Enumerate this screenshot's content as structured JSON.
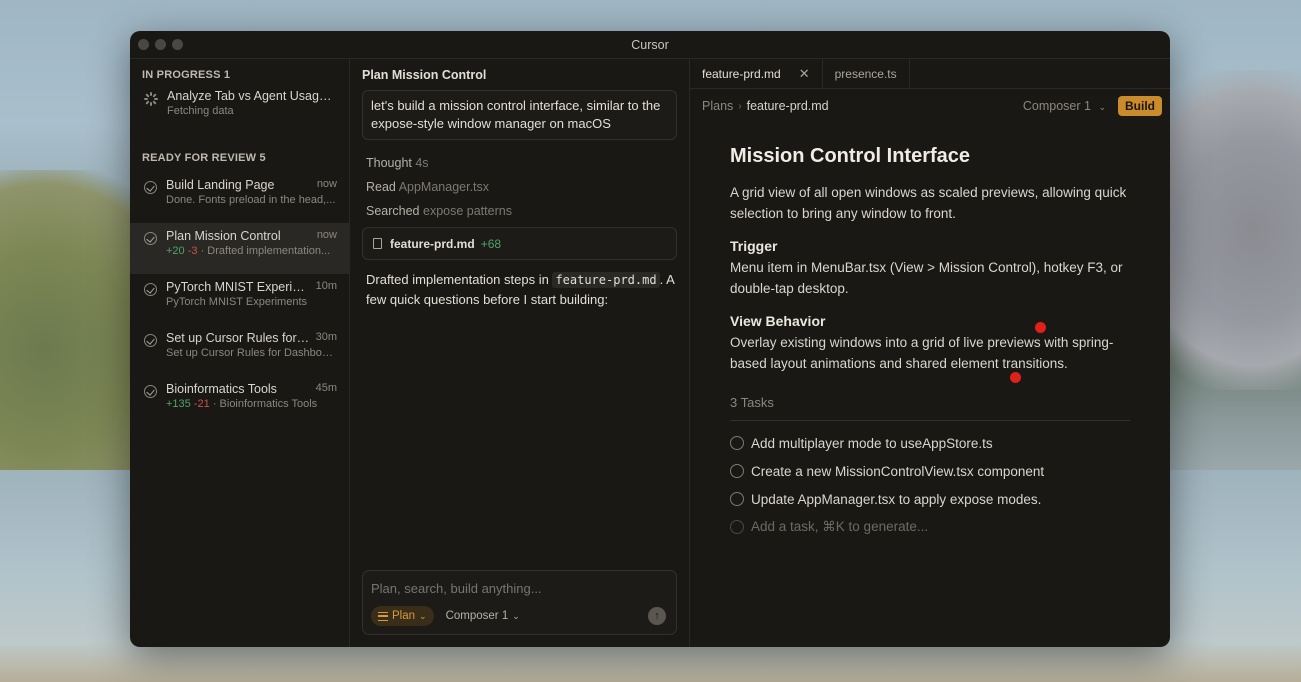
{
  "window": {
    "title": "Cursor"
  },
  "sidebar": {
    "in_progress_header": "IN PROGRESS 1",
    "in_progress": [
      {
        "title": "Analyze Tab vs Agent Usage P...",
        "subtitle": "Fetching data",
        "icon": "spinner-icon"
      }
    ],
    "review_header": "READY FOR REVIEW 5",
    "review": [
      {
        "title": "Build Landing Page",
        "time": "now",
        "plus": "",
        "minus": "",
        "subtitle": "Done. Fonts preload in the head,..."
      },
      {
        "title": "Plan Mission Control",
        "time": "now",
        "plus": "+20",
        "minus": "-3",
        "subtitle": "· Drafted implementation...",
        "active": true
      },
      {
        "title": "PyTorch MNIST Experim...",
        "time": "10m",
        "plus": "",
        "minus": "",
        "subtitle": "PyTorch MNIST Experiments"
      },
      {
        "title": "Set up Cursor Rules for ...",
        "time": "30m",
        "plus": "",
        "minus": "",
        "subtitle": "Set up Cursor Rules for Dashboa..."
      },
      {
        "title": "Bioinformatics Tools",
        "time": "45m",
        "plus": "+135",
        "minus": "-21",
        "subtitle": "· Bioinformatics Tools"
      }
    ]
  },
  "chat": {
    "title": "Plan Mission Control",
    "prompt": "let's build a mission control interface, similar to the expose-style window manager on macOS",
    "thought_label": "Thought",
    "thought_time": "4s",
    "read_label": "Read",
    "read_file": "AppManager.tsx",
    "searched_label": "Searched",
    "searched_query": "expose patterns",
    "file_card": {
      "name": "feature-prd.md",
      "additions": "+68"
    },
    "drafted_prefix": "Drafted implementation steps in",
    "drafted_code": "feature-prd.md",
    "drafted_suffix": ". A few quick questions before I start building:",
    "input_placeholder": "Plan, search, build anything...",
    "mode_label": "Plan",
    "model_label": "Composer 1",
    "send_symbol": "↑"
  },
  "editor": {
    "tabs": [
      {
        "label": "feature-prd.md",
        "active": true,
        "close": "✕"
      },
      {
        "label": "presence.ts",
        "active": false
      }
    ],
    "breadcrumb": {
      "root": "Plans",
      "sep": "›",
      "current": "feature-prd.md"
    },
    "composer_label": "Composer 1",
    "build_label": "Build",
    "doc": {
      "title": "Mission Control Interface",
      "intro": "A grid view of all open windows as scaled previews, allowing quick selection to bring any window to front.",
      "trigger_h": "Trigger",
      "trigger_p": "Menu item in MenuBar.tsx (View > Mission Control), hotkey F3, or double-tap desktop.",
      "view_h": "View Behavior",
      "view_p": "Overlay existing windows into a grid of live previews with spring-based layout animations and shared element transitions.",
      "tasks_h": "3 Tasks",
      "tasks": [
        "Add multiplayer mode to useAppStore.ts",
        "Create a new MissionControlView.tsx component",
        "Update AppManager.tsx to apply expose modes."
      ],
      "task_placeholder": "Add a task, ⌘K to generate..."
    }
  },
  "colors": {
    "accent": "#c98b2b",
    "plus": "#4fa36a",
    "minus": "#c9504f",
    "pointer": "#e0201b"
  }
}
